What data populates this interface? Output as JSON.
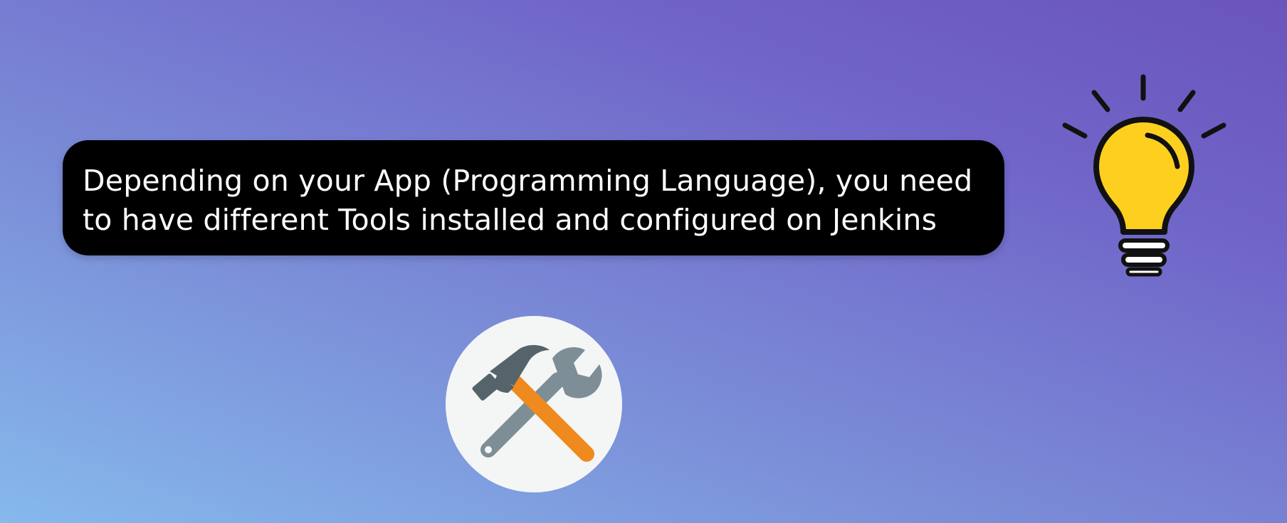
{
  "message": {
    "lines": [
      "Depending on your App (Programming Language), you need",
      "to have different Tools installed and configured on Jenkins"
    ]
  },
  "icons": {
    "idea": "lightbulb-icon",
    "tools": "hammer-wrench-icon"
  },
  "colors": {
    "background_start": "#86b9ec",
    "background_end": "#6a55bb",
    "bubble": "#000000",
    "bulb": "#fdd01f",
    "hammer_handle": "#ef8a1f",
    "wrench": "#7d8e96",
    "badge": "#f4f6f6"
  }
}
